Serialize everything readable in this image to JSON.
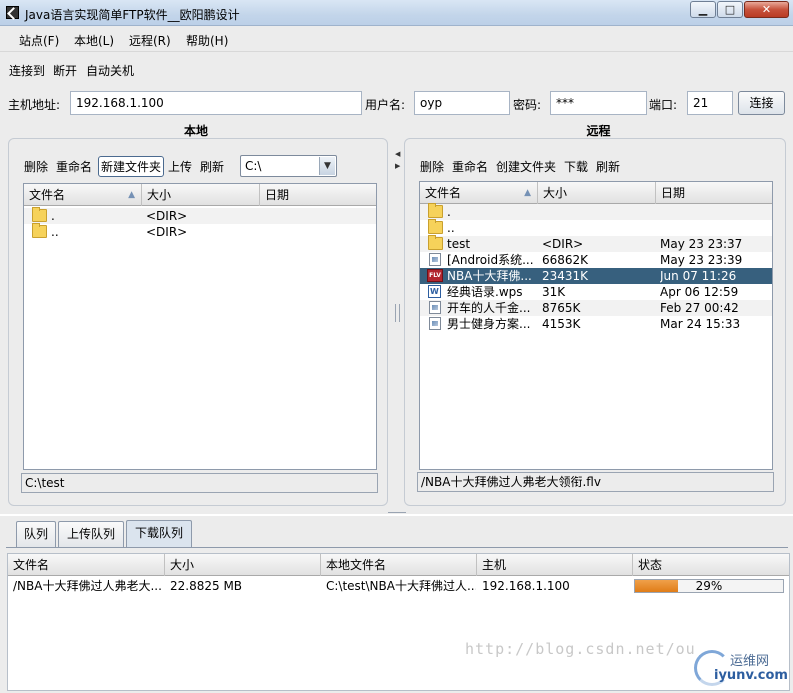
{
  "window": {
    "title": "Java语言实现简单FTP软件__欧阳鹏设计",
    "min_label": "▁",
    "max_label": "□",
    "close_label": "✕"
  },
  "menu": [
    "站点(F)",
    "本地(L)",
    "远程(R)",
    "帮助(H)"
  ],
  "toolbar": [
    "连接到",
    "断开",
    "自动关机"
  ],
  "connection": {
    "host_label": "主机地址:",
    "host_value": "192.168.1.100",
    "user_label": "用户名:",
    "user_value": "oyp",
    "password_label": "密码:",
    "password_value": "***",
    "port_label": "端口:",
    "port_value": "21",
    "connect_label": "连接"
  },
  "local": {
    "header": "本地",
    "tools": [
      "删除",
      "重命名",
      "新建文件夹",
      "上传",
      "刷新"
    ],
    "drive": "C:\\",
    "columns": [
      "文件名",
      "大小",
      "日期"
    ],
    "rows": [
      {
        "name": ".",
        "size": "<DIR>",
        "date": "",
        "icon": "folder-icon"
      },
      {
        "name": "..",
        "size": "<DIR>",
        "date": "",
        "icon": "folder-icon"
      }
    ],
    "path": "C:\\test"
  },
  "remote": {
    "header": "远程",
    "tools": [
      "删除",
      "重命名",
      "创建文件夹",
      "下载",
      "刷新"
    ],
    "columns": [
      "文件名",
      "大小",
      "日期"
    ],
    "rows": [
      {
        "name": ".",
        "size": "",
        "date": "",
        "icon": "folder-icon"
      },
      {
        "name": "..",
        "size": "",
        "date": "",
        "icon": "folder-icon"
      },
      {
        "name": "test",
        "size": "<DIR>",
        "date": "May 23 23:37",
        "icon": "folder-icon"
      },
      {
        "name": "[Android系统...",
        "size": "66862K",
        "date": "May 23 23:39",
        "icon": "image-file-icon"
      },
      {
        "name": "NBA十大拜佛...",
        "size": "23431K",
        "date": "Jun 07 11:26",
        "icon": "flv-file-icon"
      },
      {
        "name": "经典语录.wps",
        "size": "31K",
        "date": "Apr 06 12:59",
        "icon": "wps-file-icon"
      },
      {
        "name": "开车的人千金...",
        "size": "8765K",
        "date": "Feb 27 00:42",
        "icon": "image-file-icon"
      },
      {
        "name": "男士健身方案...",
        "size": "4153K",
        "date": "Mar 24 15:33",
        "icon": "image-file-icon"
      }
    ],
    "selected_index": 4,
    "path": "/NBA十大拜佛过人弗老大领衔.flv"
  },
  "queue": {
    "tabs": [
      "队列",
      "上传队列",
      "下载队列"
    ],
    "active_tab": 2,
    "columns": [
      "文件名",
      "大小",
      "本地文件名",
      "主机",
      "状态"
    ],
    "rows": [
      {
        "name": "/NBA十大拜佛过人弗老大...",
        "size": "22.8825 MB",
        "local": "C:\\test\\NBA十大拜佛过人...",
        "host": "192.168.1.100",
        "status_text": "29%",
        "progress": 0.29
      }
    ]
  },
  "watermark": "http://blog.csdn.net/ou",
  "brand": {
    "line1": "运维网",
    "line2": "iyunv.com"
  },
  "colors": {
    "selection": "#37607e",
    "progress": "#e07c18",
    "title_gradient": "#c3d5ea"
  }
}
